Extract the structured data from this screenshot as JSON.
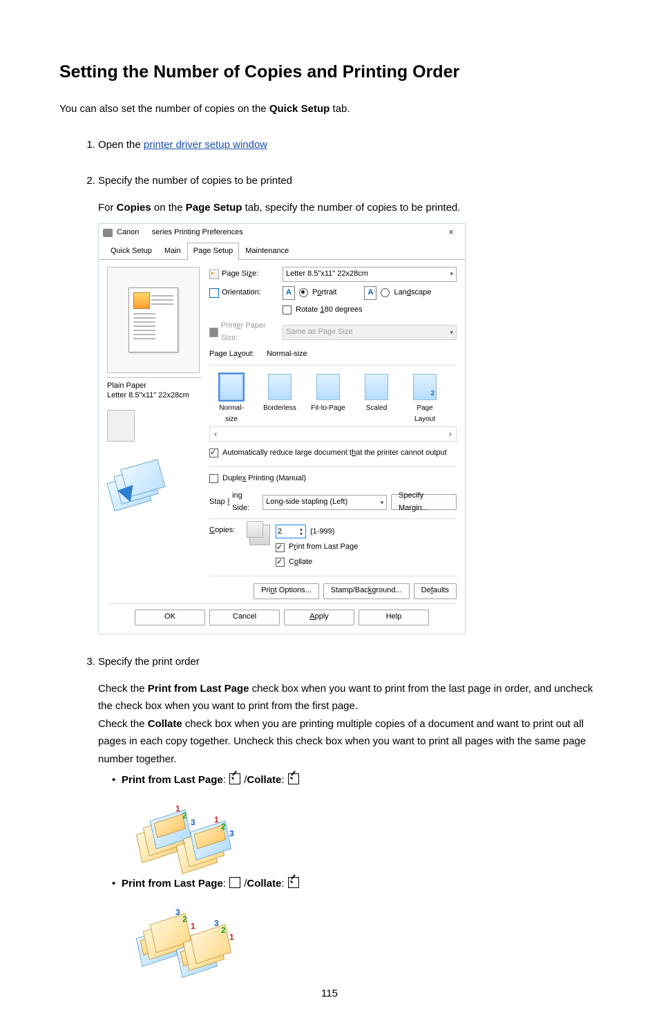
{
  "title": "Setting the Number of Copies and Printing Order",
  "intro_before": "You can also set the number of copies on the ",
  "intro_bold": "Quick Setup",
  "intro_after": " tab.",
  "steps": {
    "s1": {
      "before": "Open the ",
      "link": "printer driver setup window"
    },
    "s2": {
      "title": "Specify the number of copies to be printed",
      "body_before": "For ",
      "body_b1": "Copies",
      "body_mid": " on the ",
      "body_b2": "Page Setup",
      "body_after": " tab, specify the number of copies to be printed."
    },
    "s3": {
      "title": "Specify the print order",
      "p1_a": "Check the ",
      "p1_b": "Print from Last Page",
      "p1_c": " check box when you want to print from the last page in order, and uncheck the check box when you want to print from the first page.",
      "p2_a": "Check the ",
      "p2_b": "Collate",
      "p2_c": " check box when you are printing multiple copies of a document and want to print out all pages in each copy together. Uncheck this check box when you want to print all pages with the same page number together.",
      "li1_a": "Print from Last Page",
      "li1_b": "Collate",
      "li2_a": "Print from Last Page",
      "li2_b": "Collate"
    }
  },
  "dlg": {
    "title_brand": "Canon",
    "title_rest": "series Printing Preferences",
    "close": "×",
    "tabs": {
      "t1": "Quick Setup",
      "t2": "Main",
      "t3": "Page Setup",
      "t4": "Maintenance"
    },
    "caption_line1": "Plain Paper",
    "caption_line2": "Letter 8.5\"x11\" 22x28cm",
    "labels": {
      "page_size": "Page Size:",
      "orientation": "Orientation:",
      "portrait": "Portrait",
      "landscape": "Landscape",
      "rotate": "Rotate 180 degrees",
      "printer_paper_size": "Printer Paper Size:",
      "same_pps": "Same as Page Size",
      "page_layout": "Page Layout:",
      "page_layout_val": "Normal-size",
      "auto_reduce": "Automatically reduce large document that the printer cannot output",
      "duplex": "Duplex Printing (Manual)",
      "stapling": "Stapling Side:",
      "stapling_val": "Long-side stapling (Left)",
      "specify_margin": "Specify Margin...",
      "copies": "Copies:",
      "copies_val": "2",
      "copies_range": "(1-999)",
      "print_last": "Print from Last Page",
      "collate": "Collate",
      "print_options": "Print Options...",
      "stamp_bg": "Stamp/Background...",
      "defaults": "Defaults",
      "ok": "OK",
      "cancel": "Cancel",
      "apply": "Apply",
      "help": "Help"
    },
    "page_size_val": "Letter 8.5\"x11\" 22x28cm",
    "layouts": {
      "l1": "Normal-size",
      "l2": "Borderless",
      "l3": "Fit-to-Page",
      "l4": "Scaled",
      "l5": "Page Layout"
    }
  },
  "pagenum": "115"
}
